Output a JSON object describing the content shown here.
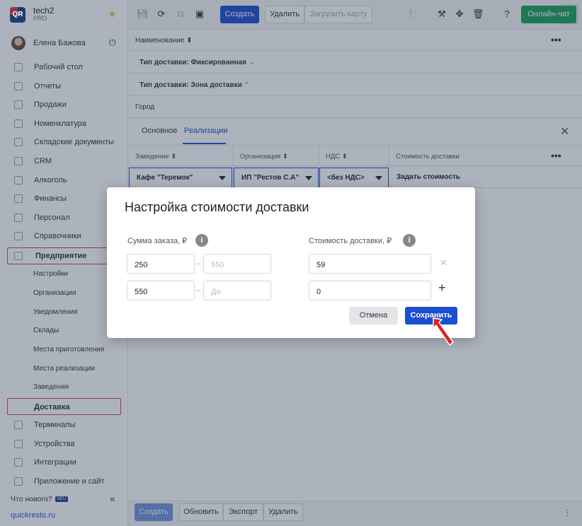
{
  "app": {
    "name": "tech2",
    "plan": "PRO",
    "logo_text": "QR"
  },
  "user": {
    "name": "Елена Бажова"
  },
  "sidebar": {
    "items": [
      {
        "label": "Рабочий стол",
        "icon": "dashboard-icon"
      },
      {
        "label": "Отчеты",
        "icon": "reports-icon"
      },
      {
        "label": "Продажи",
        "icon": "sales-icon"
      },
      {
        "label": "Номенклатура",
        "icon": "nomenclature-icon"
      },
      {
        "label": "Складские документы",
        "icon": "warehouse-icon"
      },
      {
        "label": "CRM",
        "icon": "crm-icon"
      },
      {
        "label": "Алкоголь",
        "icon": "alcohol-icon"
      },
      {
        "label": "Финансы",
        "icon": "finance-icon"
      },
      {
        "label": "Персонал",
        "icon": "staff-icon"
      },
      {
        "label": "Справочники",
        "icon": "reference-icon"
      },
      {
        "label": "Предприятие",
        "icon": "enterprise-icon"
      }
    ],
    "enterprise_sub": [
      "Настройки",
      "Организации",
      "Уведомления",
      "Склады",
      "Места приготовления",
      "Места реализации",
      "Заведения",
      "Доставка"
    ],
    "bottom_items": [
      {
        "label": "Терминалы",
        "icon": "terminal-icon"
      },
      {
        "label": "Устройства",
        "icon": "devices-icon"
      },
      {
        "label": "Интеграции",
        "icon": "integrations-icon"
      },
      {
        "label": "Приложение и сайт",
        "icon": "app-icon"
      }
    ],
    "whats_new": "Что нового?",
    "new_badge": "NEU",
    "site": "quickresto.ru"
  },
  "toolbar": {
    "create": "Создать",
    "delete": "Удалить",
    "load_map": "Загрузить карту",
    "chat": "Онлайн-чат"
  },
  "list": {
    "name_header": "Наименование",
    "group1": "Тип доставки: Фиксированная",
    "group2": "Тип доставки: Зона доставки",
    "city": "Город"
  },
  "tabs": [
    "Основное",
    "Реализации"
  ],
  "table": {
    "headers": [
      "Заведение",
      "Организация",
      "НДС",
      "Стоимость доставки"
    ],
    "row": [
      "Кафе \"Теремок\"",
      "ИП \"Рестов С.А\"",
      "<без НДС>",
      "Задать стоимость"
    ]
  },
  "footer": {
    "create": "Создать",
    "refresh": "Обновить",
    "export": "Экспорт",
    "delete": "Удалить"
  },
  "modal": {
    "title": "Настройка стоимости доставки",
    "order_sum_label": "Сумма заказа, ₽",
    "delivery_cost_label": "Стоимость доставки, ₽",
    "rows": [
      {
        "from": "250",
        "to": "",
        "to_placeholder": "550",
        "cost": "59"
      },
      {
        "from": "550",
        "to": "",
        "to_placeholder": "До",
        "cost": "0"
      }
    ],
    "cancel": "Отмена",
    "save": "Сохранить"
  }
}
